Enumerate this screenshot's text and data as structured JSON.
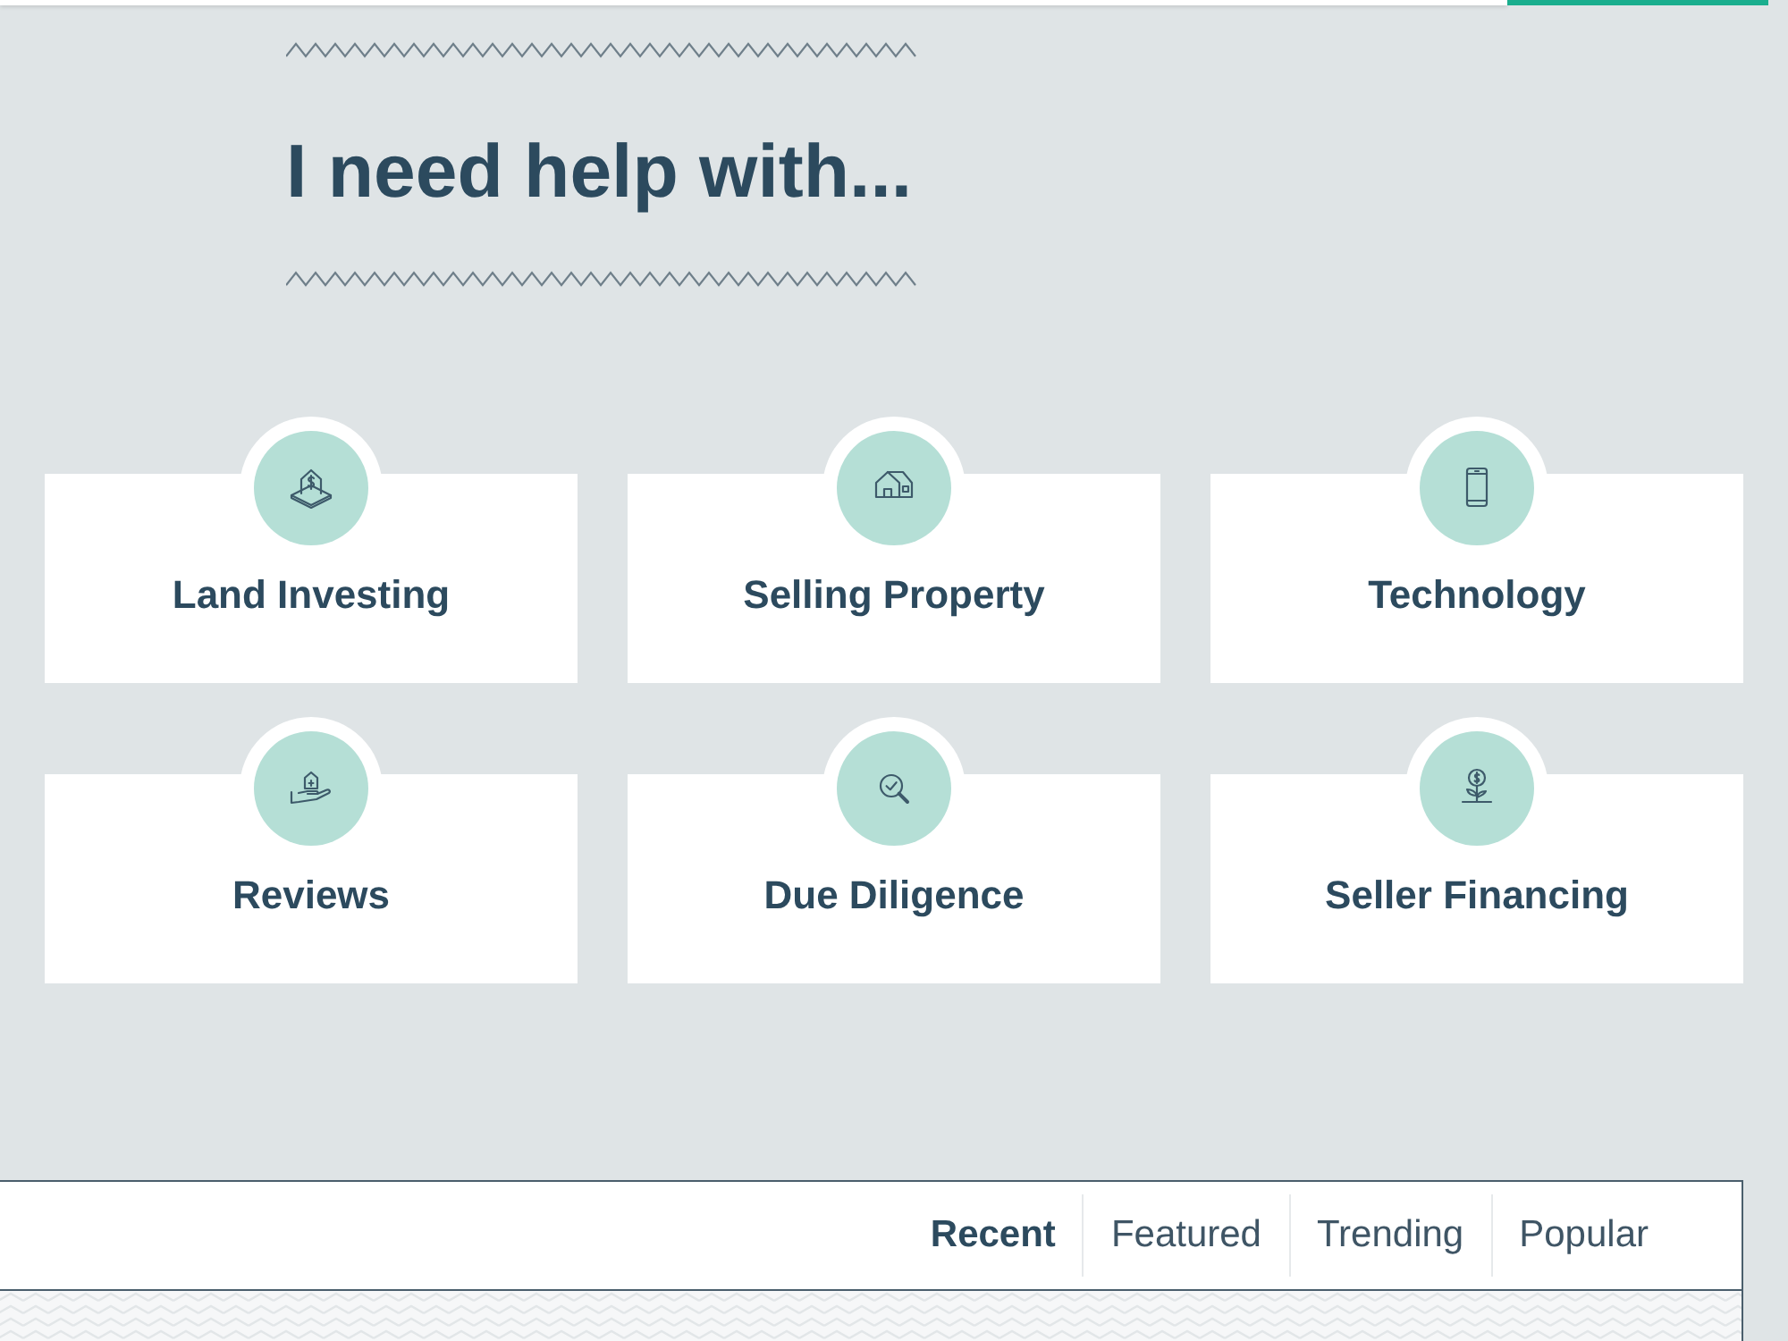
{
  "heading": "I need help with...",
  "categories": [
    {
      "label": "Land Investing",
      "kind": "land"
    },
    {
      "label": "Selling Property",
      "kind": "house"
    },
    {
      "label": "Technology",
      "kind": "phone"
    },
    {
      "label": "Reviews",
      "kind": "hand"
    },
    {
      "label": "Due Diligence",
      "kind": "search"
    },
    {
      "label": "Seller Financing",
      "kind": "plant"
    }
  ],
  "tabs": [
    {
      "label": "Recent",
      "selected": true
    },
    {
      "label": "Featured",
      "selected": false
    },
    {
      "label": "Trending",
      "selected": false
    },
    {
      "label": "Popular",
      "selected": false
    }
  ]
}
